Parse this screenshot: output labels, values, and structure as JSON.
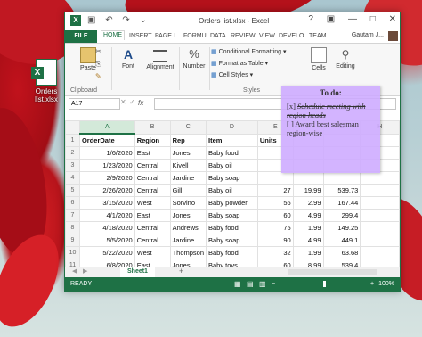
{
  "desktop": {
    "icon_label": "Orders list.xlsx",
    "icon_badge": "X"
  },
  "window": {
    "title": "Orders list.xlsx - Excel",
    "app_badge": "X",
    "qat": {
      "save": "▣",
      "undo": "↶",
      "redo": "↷",
      "more": "⌄"
    },
    "controls": {
      "help": "?",
      "options": "▣",
      "minimize": "—",
      "maximize": "□",
      "close": "✕"
    }
  },
  "tabs": [
    "FILE",
    "HOME",
    "INSERT",
    "PAGE L",
    "FORMU",
    "DATA",
    "REVIEW",
    "VIEW",
    "DEVELO",
    "TEAM"
  ],
  "user": "Gautam J...",
  "ribbon": {
    "paste": "Paste",
    "clipboard": "Clipboard",
    "font": "Font",
    "alignment": "Alignment",
    "number": "Number",
    "conditional": "Conditional Formatting",
    "format_table": "Format as Table",
    "cell_styles": "Cell Styles",
    "styles": "Styles",
    "cells": "Cells",
    "editing": "Editing"
  },
  "formula_bar": {
    "name_box": "A17",
    "fx": "fx",
    "value": ""
  },
  "columns": [
    "A",
    "B",
    "C",
    "D",
    "E",
    "F",
    "G",
    "H"
  ],
  "rows": [
    {
      "n": "1",
      "cells": [
        "OrderDate",
        "Region",
        "Rep",
        "Item",
        "Units",
        "",
        "",
        ""
      ]
    },
    {
      "n": "2",
      "cells": [
        "1/6/2020",
        "East",
        "Jones",
        "Baby food",
        "",
        "",
        "",
        ""
      ]
    },
    {
      "n": "3",
      "cells": [
        "1/23/2020",
        "Central",
        "Kivell",
        "Baby oil",
        "",
        "",
        "",
        ""
      ]
    },
    {
      "n": "4",
      "cells": [
        "2/9/2020",
        "Central",
        "Jardine",
        "Baby soap",
        "",
        "",
        "",
        ""
      ]
    },
    {
      "n": "5",
      "cells": [
        "2/26/2020",
        "Central",
        "Gill",
        "Baby oil",
        "27",
        "19.99",
        "539.73",
        ""
      ]
    },
    {
      "n": "6",
      "cells": [
        "3/15/2020",
        "West",
        "Sorvino",
        "Baby powder",
        "56",
        "2.99",
        "167.44",
        ""
      ]
    },
    {
      "n": "7",
      "cells": [
        "4/1/2020",
        "East",
        "Jones",
        "Baby soap",
        "60",
        "4.99",
        "299.4",
        ""
      ]
    },
    {
      "n": "8",
      "cells": [
        "4/18/2020",
        "Central",
        "Andrews",
        "Baby food",
        "75",
        "1.99",
        "149.25",
        ""
      ]
    },
    {
      "n": "9",
      "cells": [
        "5/5/2020",
        "Central",
        "Jardine",
        "Baby soap",
        "90",
        "4.99",
        "449.1",
        ""
      ]
    },
    {
      "n": "10",
      "cells": [
        "5/22/2020",
        "West",
        "Thompson",
        "Baby food",
        "32",
        "1.99",
        "63.68",
        ""
      ]
    },
    {
      "n": "11",
      "cells": [
        "6/8/2020",
        "East",
        "Jones",
        "Baby toys",
        "60",
        "8.99",
        "539.4",
        ""
      ]
    },
    {
      "n": "12",
      "cells": [
        "",
        "",
        "",
        "",
        "",
        "",
        "",
        ""
      ]
    }
  ],
  "sheet_tab": "Sheet1",
  "add_sheet": "+",
  "status": {
    "ready": "READY",
    "zoom": "100%"
  },
  "sticky_note": {
    "title": "To do:",
    "item1_box": "[x]",
    "item1_text": "Schedule meeting with region heads",
    "item2_box": "[ ]",
    "item2_text": "Award best salesman region-wise"
  }
}
